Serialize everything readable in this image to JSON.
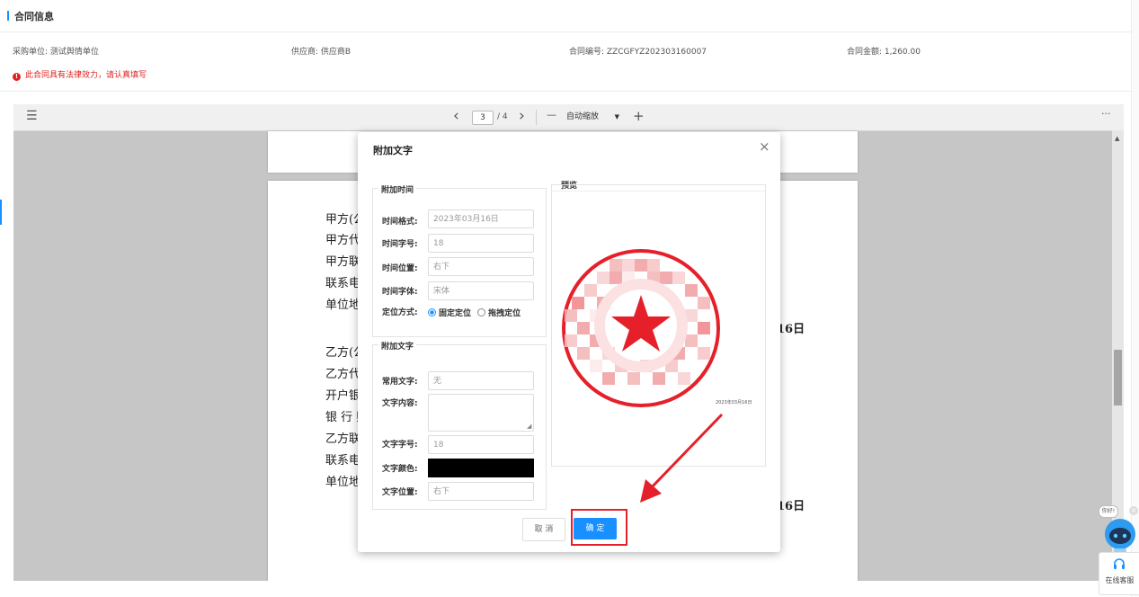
{
  "header": {
    "title": "合同信息",
    "purchaser": "采购单位: 测试舆情单位",
    "supplier": "供应商: 供应商B",
    "contract_no": "合同编号: ZZCGFYZ202303160007",
    "amount": "合同金额: 1,260.00",
    "warning": "此合同具有法律效力，请认真填写",
    "warning_icon": "!"
  },
  "viewer": {
    "menu_icon": "☰",
    "prev": "‹",
    "next": "›",
    "page": "3",
    "total": "/ 4",
    "zoom_out": "—",
    "zoom": "自动缩放",
    "zoom_in": "+",
    "more": "···",
    "lines_a": [
      "甲方(公",
      "甲方代",
      "甲方联",
      "联系电",
      "单位地"
    ],
    "lines_b": [
      "乙方(公",
      "乙方代",
      "开户银",
      "银  行  账",
      "乙方联",
      "联系电",
      "单位地"
    ],
    "date_suffix": "16日"
  },
  "dialog": {
    "title": "附加文字",
    "close": "×",
    "time_section": "附加时间",
    "time_format_label": "时间格式:",
    "time_format_value": "2023年03月16日",
    "time_size_label": "时间字号:",
    "time_size_value": "18",
    "time_position_label": "时间位置:",
    "time_position_value": "右下",
    "time_font_label": "时间字体:",
    "time_font_value": "宋体",
    "locate_label": "定位方式:",
    "locate_fixed": "固定定位",
    "locate_drag": "拖拽定位",
    "text_section": "附加文字",
    "common_text_label": "常用文字:",
    "common_text_value": "无",
    "content_label": "文字内容:",
    "content_value": "",
    "text_size_label": "文字字号:",
    "text_size_value": "18",
    "text_color_label": "文字颜色:",
    "text_color_value": "#000000",
    "text_position_label": "文字位置:",
    "text_position_value": "右下",
    "preview_title": "预览",
    "preview_date": "2023年03月16日",
    "cancel": "取 消",
    "confirm": "确 定"
  },
  "service": {
    "bubble": "你好!",
    "label": "在线客服"
  },
  "colors": {
    "accent": "#1890ff",
    "stamp": "#e5202a",
    "warning": "#e02020"
  }
}
